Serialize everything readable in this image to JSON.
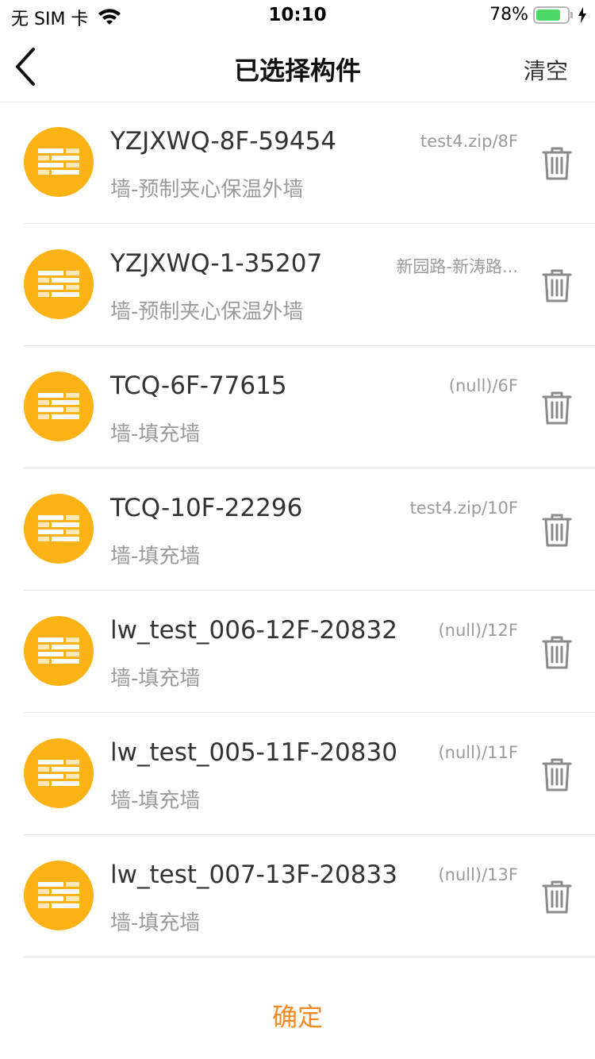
{
  "status_bar": {
    "carrier": "无 SIM 卡",
    "time": "10:10",
    "battery_percent": "78%",
    "battery_level": 0.78
  },
  "nav": {
    "title": "已选择构件",
    "clear_label": "清空"
  },
  "items": [
    {
      "title": "YZJXWQ-8F-59454",
      "subtitle": "墙-预制夹心保温外墙",
      "path": "test4.zip/8F"
    },
    {
      "title": "YZJXWQ-1-35207",
      "subtitle": "墙-预制夹心保温外墙",
      "path": "新园路-新涛路..."
    },
    {
      "title": "TCQ-6F-77615",
      "subtitle": "墙-填充墙",
      "path": "(null)/6F"
    },
    {
      "title": "TCQ-10F-22296",
      "subtitle": "墙-填充墙",
      "path": "test4.zip/10F"
    },
    {
      "title": "lw_test_006-12F-20832",
      "subtitle": "墙-填充墙",
      "path": "(null)/12F"
    },
    {
      "title": "lw_test_005-11F-20830",
      "subtitle": "墙-填充墙",
      "path": "(null)/11F"
    },
    {
      "title": "lw_test_007-13F-20833",
      "subtitle": "墙-填充墙",
      "path": "(null)/13F"
    }
  ],
  "footer": {
    "confirm_label": "确定"
  },
  "colors": {
    "accent": "#f58a1f",
    "avatar": "#fbb215",
    "battery": "#4cd964"
  },
  "icons": {
    "back": "chevron-left-icon",
    "item": "brick-wall-icon",
    "delete": "trash-icon"
  }
}
